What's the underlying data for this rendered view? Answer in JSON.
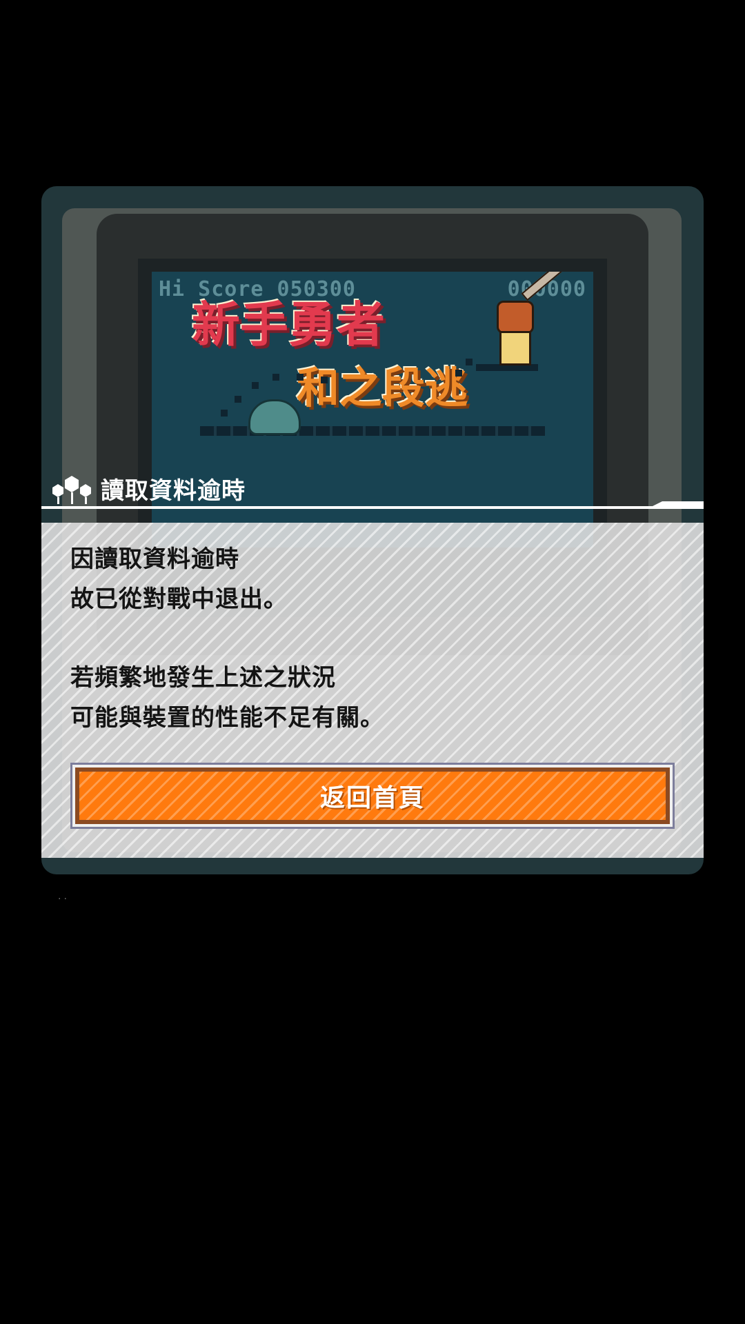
{
  "game_screen": {
    "hi_score_label": "Hi Score 050300",
    "score": "000000",
    "title_line1": "新手勇者",
    "title_line2": "和之段逃"
  },
  "dialog": {
    "title": "讀取資料逾時",
    "message_lines": [
      "因讀取資料逾時",
      "故已從對戰中退出。",
      "若頻繁地發生上述之狀況",
      "可能與裝置的性能不足有關。"
    ],
    "home_button_label": "返回首頁"
  },
  "footer": {
    "dots": "··"
  },
  "colors": {
    "background": "#000000",
    "device": "#22373b",
    "screen": "#184352",
    "button": "#ff7a0e",
    "dialog_body": "#e1e1e1"
  },
  "icons": {
    "dialog_icon": "hexagon-nodes-icon"
  }
}
